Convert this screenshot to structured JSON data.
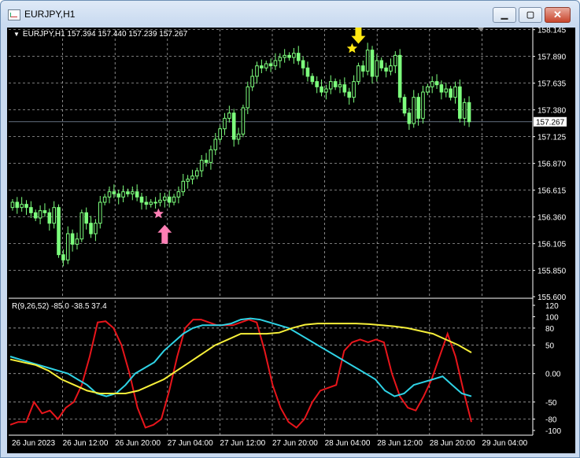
{
  "window": {
    "title": "EURJPY,H1",
    "minimize_glyph": "▁",
    "maximize_glyph": "▢",
    "close_glyph": "✕"
  },
  "info_line": "EURJPY,H1  157.394 157.440 157.239 157.267",
  "rsi_label": "R(9,26,52) -85.0 -38.5 37.4",
  "current_price_label": "157.267",
  "colors": {
    "background": "#000000",
    "grid": "#c0c0c0",
    "candle": "#7dff7d",
    "candle_wick": "#7dff7d",
    "rsi_fast": "#e8151b",
    "rsi_mid": "#2fd3e6",
    "rsi_slow": "#f7f03a",
    "arrow_buy": "#ff7fb5",
    "arrow_sell": "#ffe812",
    "star_buy": "#ff7fb5",
    "star_sell": "#ffe812"
  },
  "icons": {
    "buy_signal": "up-arrow-icon",
    "sell_signal": "down-arrow-icon",
    "star": "star-icon"
  },
  "chart_data": [
    {
      "type": "candlestick",
      "symbol": "EURJPY",
      "timeframe": "H1",
      "ylim": [
        155.6,
        158.15
      ],
      "yticks": [
        "158.145",
        "157.890",
        "157.635",
        "157.380",
        "157.125",
        "156.870",
        "156.615",
        "156.360",
        "156.105",
        "155.850",
        "155.600"
      ],
      "xticks": [
        "26 Jun 2023",
        "26 Jun 12:00",
        "26 Jun 20:00",
        "27 Jun 04:00",
        "27 Jun 12:00",
        "27 Jun 20:00",
        "28 Jun 04:00",
        "28 Jun 12:00",
        "28 Jun 20:00",
        "29 Jun 04:00"
      ],
      "current_price": 157.267,
      "closes": [
        156.5,
        156.45,
        156.48,
        156.45,
        156.4,
        156.35,
        156.42,
        156.4,
        156.3,
        156.45,
        156.0,
        155.95,
        156.2,
        156.1,
        156.15,
        156.4,
        156.3,
        156.2,
        156.3,
        156.5,
        156.55,
        156.6,
        156.58,
        156.55,
        156.6,
        156.58,
        156.6,
        156.55,
        156.5,
        156.48,
        156.5,
        156.5,
        156.52,
        156.55,
        156.5,
        156.55,
        156.6,
        156.7,
        156.72,
        156.75,
        156.8,
        156.9,
        156.88,
        157.0,
        157.1,
        157.2,
        157.3,
        157.35,
        157.1,
        157.15,
        157.4,
        157.6,
        157.7,
        157.8,
        157.78,
        157.82,
        157.8,
        157.85,
        157.88,
        157.9,
        157.88,
        157.92,
        157.85,
        157.78,
        157.7,
        157.65,
        157.6,
        157.55,
        157.58,
        157.65,
        157.6,
        157.62,
        157.55,
        157.5,
        157.65,
        157.8,
        157.75,
        157.95,
        157.7,
        157.85,
        157.78,
        157.75,
        157.8,
        157.9,
        157.5,
        157.35,
        157.25,
        157.5,
        157.3,
        157.55,
        157.6,
        157.65,
        157.62,
        157.55,
        157.58,
        157.5,
        157.6,
        157.3,
        157.45,
        157.267
      ],
      "annotations": [
        {
          "kind": "buy",
          "index": 33,
          "price": 156.36
        },
        {
          "kind": "sell",
          "index": 75,
          "price": 157.98
        }
      ]
    },
    {
      "type": "line",
      "name": "R(9,26,52)",
      "ylim": [
        -100,
        120
      ],
      "yticks": [
        "120",
        "100",
        "80",
        "50",
        "0.00",
        "-50",
        "-80",
        "-100"
      ],
      "series": [
        {
          "name": "R9",
          "values": [
            -90,
            -85,
            -85,
            -50,
            -70,
            -65,
            -80,
            -60,
            -50,
            -20,
            30,
            90,
            92,
            80,
            50,
            0,
            -60,
            -95,
            -90,
            -80,
            -30,
            30,
            80,
            95,
            95,
            90,
            85,
            85,
            85,
            90,
            95,
            90,
            40,
            -20,
            -60,
            -85,
            -95,
            -80,
            -50,
            -30,
            -25,
            -20,
            40,
            55,
            60,
            55,
            60,
            55,
            0,
            -40,
            -60,
            -65,
            -40,
            -10,
            30,
            70,
            30,
            -30,
            -85
          ]
        },
        {
          "name": "R26",
          "values": [
            30,
            25,
            20,
            15,
            10,
            5,
            0,
            -10,
            -20,
            -35,
            -40,
            -35,
            -20,
            0,
            10,
            20,
            40,
            55,
            70,
            80,
            85,
            85,
            85,
            88,
            95,
            97,
            95,
            90,
            85,
            80,
            70,
            60,
            50,
            40,
            30,
            20,
            10,
            0,
            -10,
            -30,
            -40,
            -35,
            -20,
            -15,
            -10,
            -5,
            -20,
            -35,
            -40
          ]
        },
        {
          "name": "R52",
          "values": [
            25,
            20,
            15,
            5,
            -10,
            -20,
            -30,
            -35,
            -35,
            -35,
            -30,
            -20,
            -10,
            5,
            20,
            35,
            50,
            60,
            70,
            70,
            70,
            72,
            80,
            86,
            88,
            88,
            88,
            88,
            87,
            85,
            83,
            80,
            75,
            70,
            60,
            50,
            37
          ]
        }
      ]
    }
  ]
}
